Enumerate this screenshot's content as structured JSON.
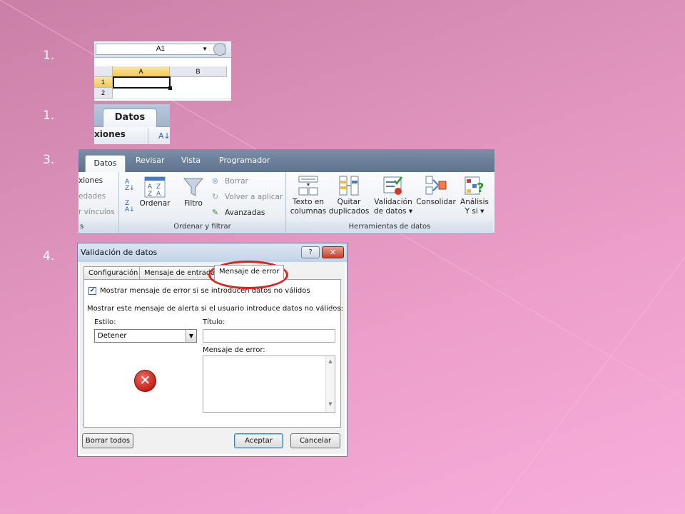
{
  "steps": [
    "1.",
    "1.",
    "3.",
    "4."
  ],
  "step1": {
    "namebox_value": "A1",
    "col_a": "A",
    "col_b": "B",
    "row1": "1",
    "row2": "2"
  },
  "step2": {
    "tab_label": "Datos",
    "partial_text": "xiones"
  },
  "ribbon": {
    "tabs": [
      "Datos",
      "Revisar",
      "Vista",
      "Programador"
    ],
    "connections_items": [
      "xiones",
      "edades",
      "r vínculos"
    ],
    "connections_group_partial": "s",
    "sort_button": "Ordenar",
    "filter_button": "Filtro",
    "clear_label": "Borrar",
    "reapply_label": "Volver a aplicar",
    "advanced_label": "Avanzadas",
    "sort_filter_group": "Ordenar y filtrar",
    "text_to_columns": [
      "Texto en",
      "columnas"
    ],
    "remove_duplicates": [
      "Quitar",
      "duplicados"
    ],
    "data_validation": [
      "Validación",
      "de datos ▾"
    ],
    "consolidate": "Consolidar",
    "whatif": [
      "Análisis",
      "Y si ▾"
    ],
    "data_tools_group": "Herramientas de datos"
  },
  "dialog": {
    "title": "Validación de datos",
    "help": "?",
    "close": "✕",
    "tabs": [
      "Configuración",
      "Mensaje de entrada",
      "Mensaje de error"
    ],
    "show_error_checkbox": "Mostrar mensaje de error si se introducen datos no válidos",
    "show_error_checked": true,
    "section_label": "Mostrar este mensaje de alerta si el usuario introduce datos no válidos:",
    "style_label": "Estilo:",
    "style_value": "Detener",
    "title_label": "Título:",
    "title_value": "",
    "error_message_label": "Mensaje de error:",
    "error_message_value": "",
    "clear_all_button": "Borrar todos",
    "ok_button": "Aceptar",
    "cancel_button": "Cancelar"
  },
  "colors": {
    "background": "#e69ac5",
    "highlight_oval": "#e0201c",
    "ribbon_tabs": "#6a7d99"
  }
}
